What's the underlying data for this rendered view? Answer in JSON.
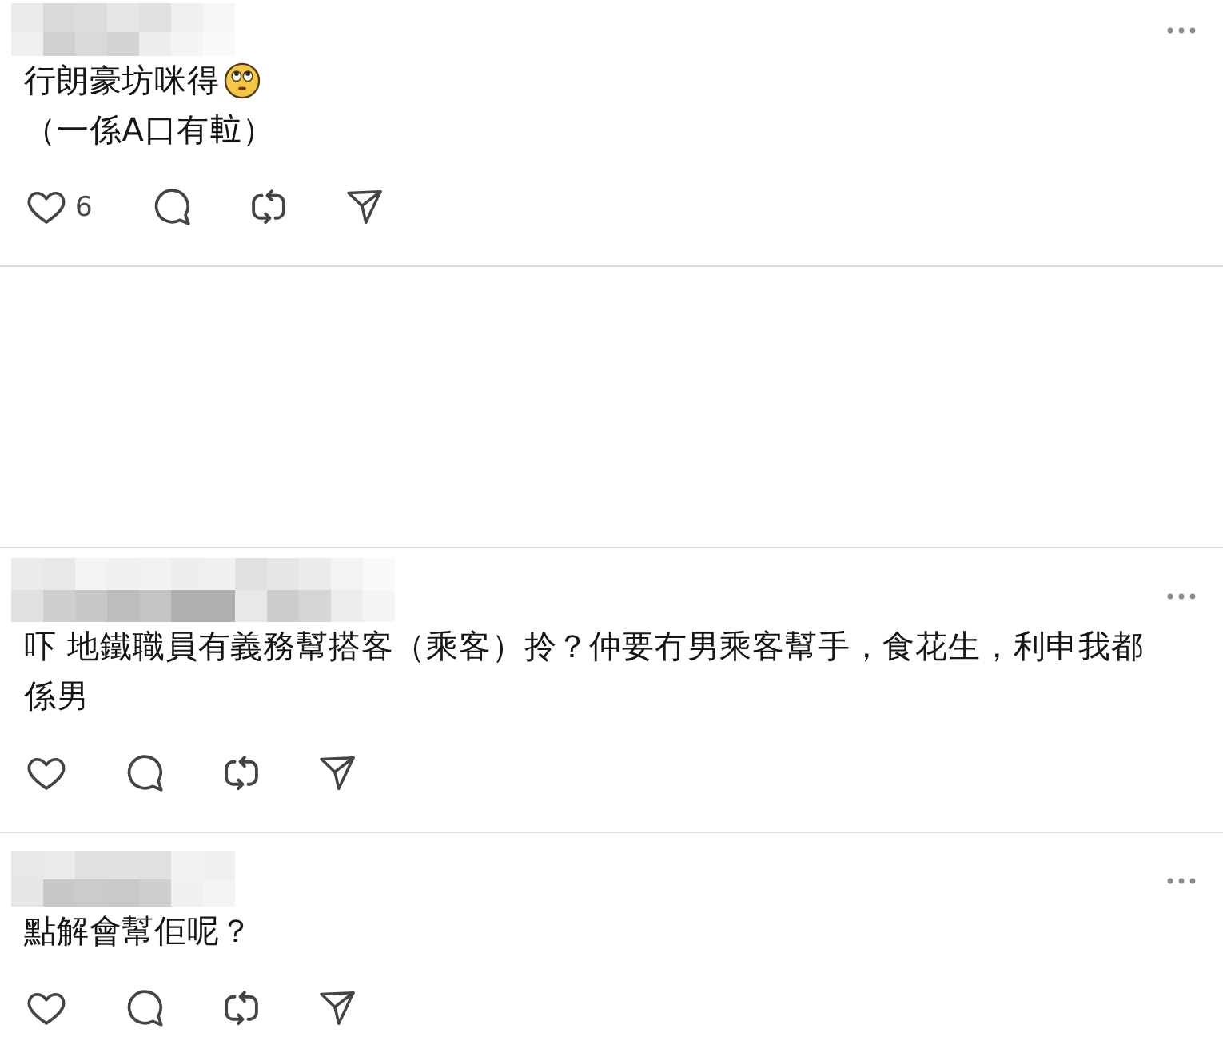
{
  "feed": [
    {
      "kind": "post",
      "paragraphs": [
        {
          "text": "行朗豪坊咪得",
          "emoji": true
        },
        {
          "text": "（一係A口有𨋢）",
          "emoji": false
        }
      ],
      "like_count": "6"
    },
    {
      "kind": "blank"
    },
    {
      "kind": "post",
      "paragraphs": [
        {
          "text": "吓 地鐵職員有義務幫搭客（乘客）拎？仲要冇男乘客幫手，食花生，利申我都係男",
          "emoji": false
        }
      ]
    },
    {
      "kind": "post",
      "paragraphs": [
        {
          "text": "點解會幫佢呢？",
          "emoji": false
        }
      ]
    }
  ]
}
